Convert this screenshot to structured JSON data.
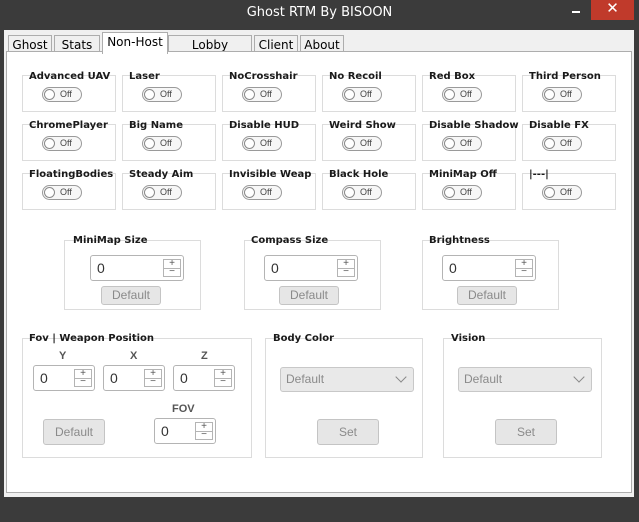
{
  "window": {
    "title": "Ghost RTM By BISOON"
  },
  "tabs": [
    {
      "label": "Ghost"
    },
    {
      "label": "Stats"
    },
    {
      "label": "Non-Host"
    },
    {
      "label": "Lobby Setting"
    },
    {
      "label": "Client"
    },
    {
      "label": "About"
    }
  ],
  "toggles": [
    {
      "label": "Advanced UAV",
      "state": "Off"
    },
    {
      "label": "Laser",
      "state": "Off"
    },
    {
      "label": "NoCrosshair",
      "state": "Off"
    },
    {
      "label": "No Recoil",
      "state": "Off"
    },
    {
      "label": "Red Box",
      "state": "Off"
    },
    {
      "label": "Third Person",
      "state": "Off"
    },
    {
      "label": "ChromePlayer",
      "state": "Off"
    },
    {
      "label": "Big Name",
      "state": "Off"
    },
    {
      "label": "Disable HUD",
      "state": "Off"
    },
    {
      "label": "Weird Show",
      "state": "Off"
    },
    {
      "label": "Disable Shadow",
      "state": "Off"
    },
    {
      "label": "Disable FX",
      "state": "Off"
    },
    {
      "label": "FloatingBodies",
      "state": "Off"
    },
    {
      "label": "Steady Aim",
      "state": "Off"
    },
    {
      "label": "Invisible Weap",
      "state": "Off"
    },
    {
      "label": "Black Hole",
      "state": "Off"
    },
    {
      "label": "MiniMap Off",
      "state": "Off"
    },
    {
      "label": "|---|",
      "state": "Off"
    }
  ],
  "sliders": {
    "minimap": {
      "label": "MiniMap Size",
      "value": "0",
      "button": "Default"
    },
    "compass": {
      "label": "Compass Size",
      "value": "0",
      "button": "Default"
    },
    "brightness": {
      "label": "Brightness",
      "value": "0",
      "button": "Default"
    }
  },
  "fov": {
    "label": "Fov | Weapon Position",
    "y_label": "Y",
    "y_value": "0",
    "x_label": "X",
    "x_value": "0",
    "z_label": "Z",
    "z_value": "0",
    "default_button": "Default",
    "fov_label": "FOV",
    "fov_value": "0"
  },
  "body_color": {
    "label": "Body Color",
    "selected": "Default",
    "button": "Set"
  },
  "vision": {
    "label": "Vision",
    "selected": "Default",
    "button": "Set"
  },
  "spin_symbols": {
    "up": "+",
    "down": "−"
  },
  "window_controls": {
    "close": "✕"
  }
}
